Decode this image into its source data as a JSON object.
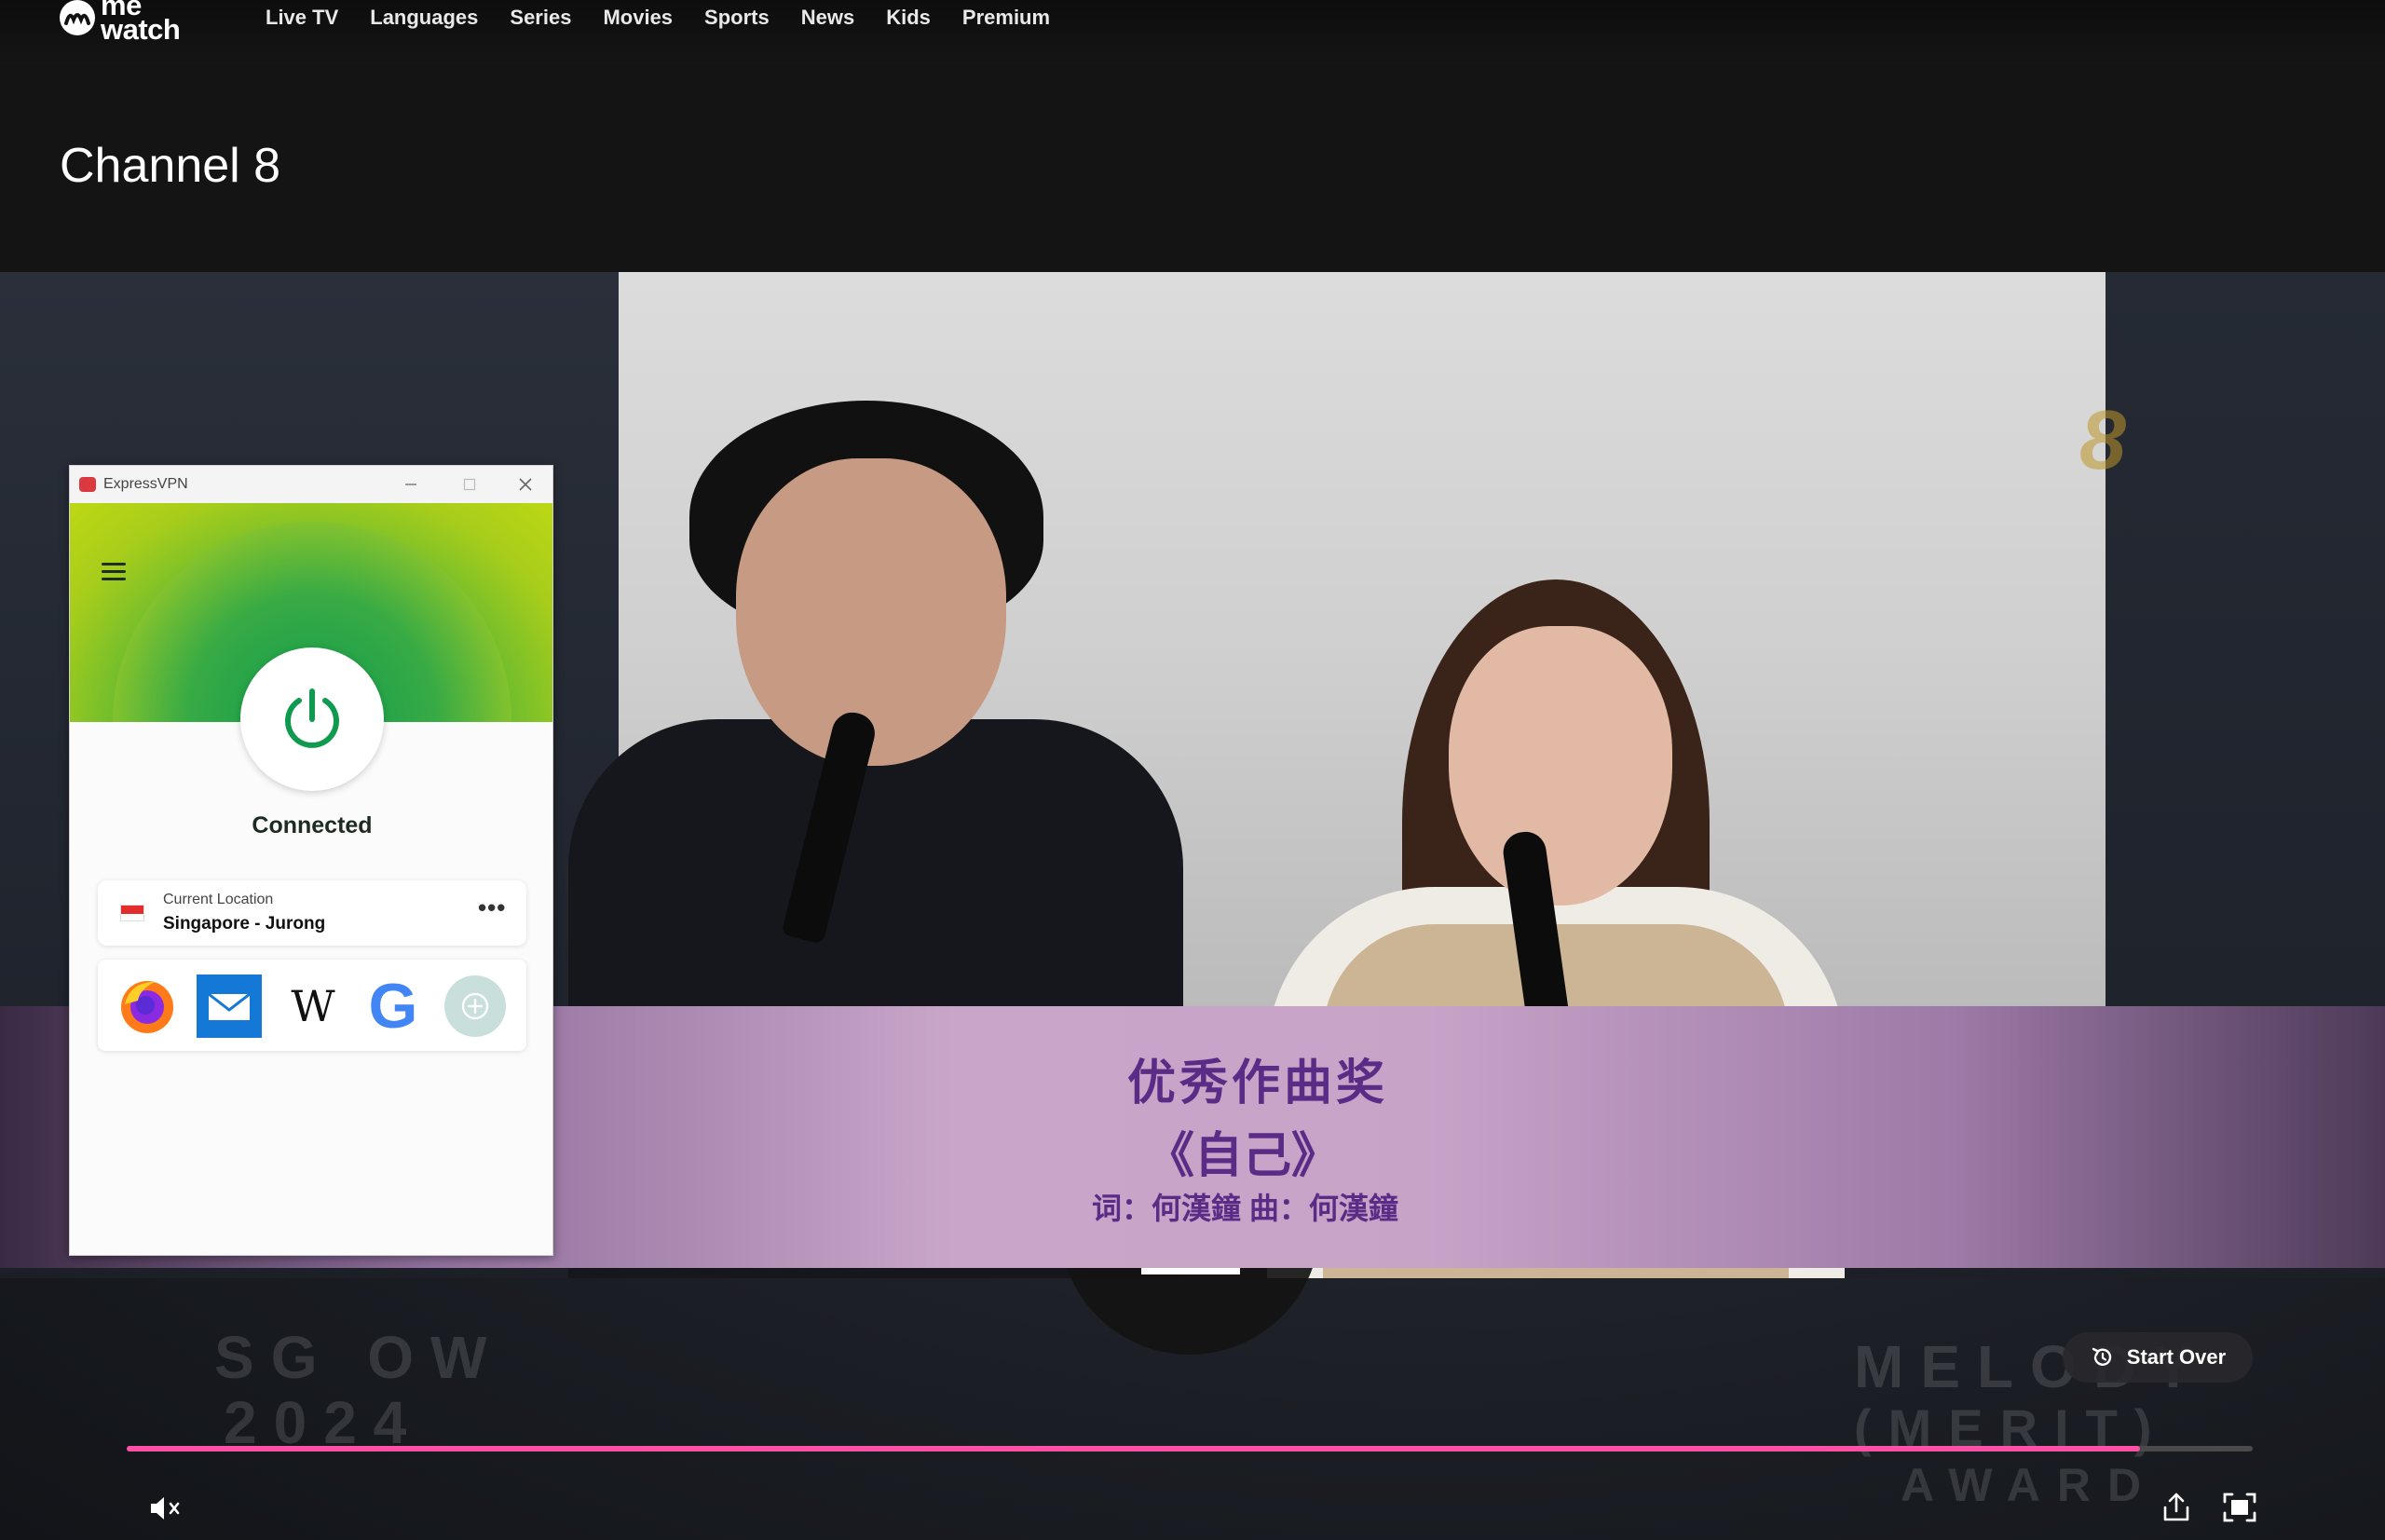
{
  "app": {
    "logo_text": "me watch",
    "logo_line1": "me",
    "logo_line2": "watch"
  },
  "nav": {
    "items": [
      {
        "label": "Live TV"
      },
      {
        "label": "Languages"
      },
      {
        "label": "Series"
      },
      {
        "label": "Movies"
      },
      {
        "label": "Sports"
      },
      {
        "label": "News"
      },
      {
        "label": "Kids"
      },
      {
        "label": "Premium"
      }
    ]
  },
  "page": {
    "title": "Channel 8"
  },
  "player": {
    "channel_logo": "8",
    "caption": {
      "award": "优秀作曲奖",
      "song": "《自己》",
      "credit": "词：何漢鐘  曲：何漢鐘",
      "ghost_left": "SG OW",
      "ghost_left2": "2024",
      "ghost_right": "MELODY",
      "ghost_right2": "(MERIT)",
      "ghost_right3": "AWARD"
    },
    "stop_icon": "stop-icon",
    "start_over_label": "Start Over",
    "progress_percent": 94.7,
    "colors": {
      "progress": "#ff4fa6",
      "track": "#4a4a4a"
    },
    "controls": {
      "mute_icon": "muted-speaker-icon",
      "share_icon": "share-icon",
      "fullscreen_icon": "fullscreen-icon"
    }
  },
  "vpn": {
    "window_title": "ExpressVPN",
    "status": "Connected",
    "location_label": "Current Location",
    "location_value": "Singapore - Jurong",
    "more_label": "•••",
    "shortcuts": [
      {
        "name": "firefox-icon"
      },
      {
        "name": "mail-icon"
      },
      {
        "name": "wikipedia-icon",
        "glyph": "W"
      },
      {
        "name": "google-icon",
        "glyph": "G"
      },
      {
        "name": "add-shortcut-icon"
      }
    ],
    "colors": {
      "brand_red": "#da3940",
      "connected_green": "#0f9a4f"
    }
  }
}
